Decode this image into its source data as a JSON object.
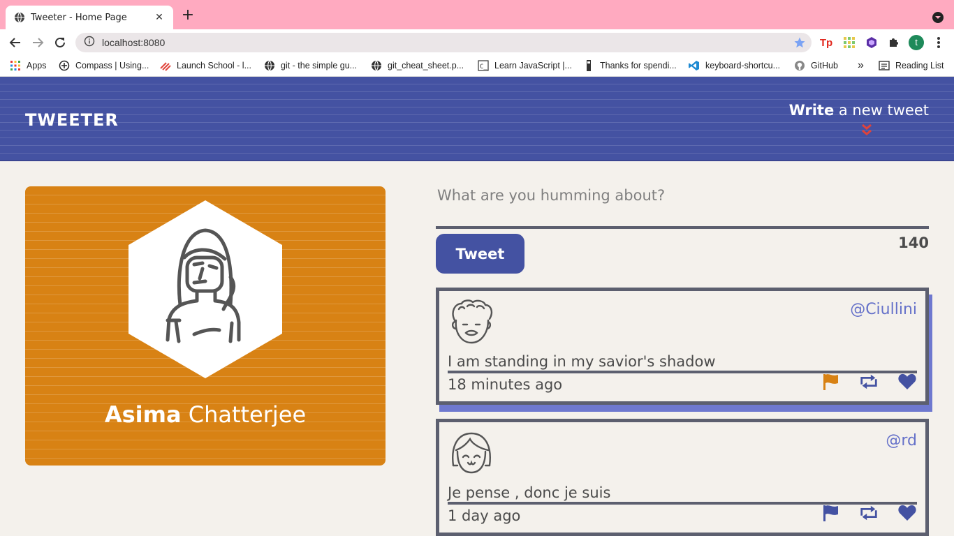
{
  "browser": {
    "tab_title": "Tweeter - Home Page",
    "url": "localhost:8080",
    "profile_initial": "t",
    "bookmarks": [
      {
        "label": "Apps",
        "icon": "apps-grid-icon"
      },
      {
        "label": "Compass | Using...",
        "icon": "compass-icon"
      },
      {
        "label": "Launch School - l...",
        "icon": "launch-school-icon"
      },
      {
        "label": "git - the simple gu...",
        "icon": "globe-icon"
      },
      {
        "label": "git_cheat_sheet.p...",
        "icon": "globe-icon"
      },
      {
        "label": "Learn JavaScript |...",
        "icon": "codecademy-icon"
      },
      {
        "label": "Thanks for spendi...",
        "icon": "page-icon"
      },
      {
        "label": "keyboard-shortcu...",
        "icon": "vscode-icon"
      },
      {
        "label": "GitHub",
        "icon": "github-icon"
      }
    ],
    "overflow_label": "»",
    "reading_list": "Reading List"
  },
  "header": {
    "logo": "TWEETER",
    "write_bold": "Write",
    "write_rest": " a new tweet"
  },
  "profile": {
    "first_name": "Asima",
    "last_name": " Chatterjee"
  },
  "compose": {
    "placeholder": "What are you humming about?",
    "button_label": "Tweet",
    "counter": "140"
  },
  "tweets": [
    {
      "handle": "@Ciullini",
      "content": "I am standing in my savior's shadow",
      "time": "18 minutes ago"
    },
    {
      "handle": "@rd",
      "content": "Je pense , donc je suis",
      "time": "1 day ago"
    }
  ],
  "colors": {
    "header_bg": "#4452a2",
    "profile_bg": "#d88214",
    "flag_orange": "#d88214",
    "flag_blue": "#4452a2",
    "border_gray": "#5c5f6f",
    "handle_color": "#6571c9"
  }
}
